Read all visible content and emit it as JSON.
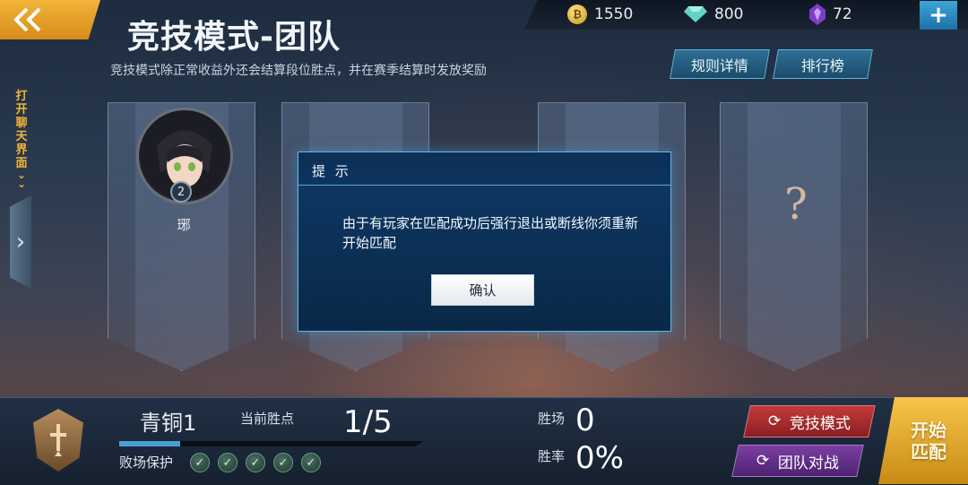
{
  "header": {
    "title": "竞技模式-团队",
    "subtitle": "竞技模式除正常收益外还会结算段位胜点，并在赛季结算时发放奖励",
    "back_icon": "double-chevron-left-icon",
    "buttons": {
      "rules": "规则详情",
      "leaderboard": "排行榜"
    }
  },
  "currency": {
    "gold": "1550",
    "diamond": "800",
    "crystal": "72",
    "add_icon": "plus-icon"
  },
  "chat": {
    "label": "打开聊天界面",
    "expand_icon": "chevron-right-icon"
  },
  "team": {
    "player": {
      "name": "琊",
      "level": "2"
    },
    "empty_slot_mark": "?"
  },
  "dialog": {
    "title": "提 示",
    "message": "由于有玩家在匹配成功后强行退出或断线你须重新开始匹配",
    "confirm": "确认"
  },
  "rank": {
    "name": "青铜1",
    "points_label": "当前胜点",
    "points": "1/5",
    "points_fraction": 0.2,
    "protect_label": "败场保护",
    "protect_count": 5
  },
  "stats": {
    "wins_label": "胜场",
    "wins": "0",
    "winrate_label": "胜率",
    "winrate": "0%"
  },
  "modes": {
    "ranked": "竞技模式",
    "team_battle": "团队对战"
  },
  "start": "开始匹配",
  "colors": {
    "accent_gold": "#f2b53a",
    "dialog_blue": "#0f3a66",
    "ranked_red": "#c53a3a",
    "team_purple": "#7b3fa3"
  }
}
